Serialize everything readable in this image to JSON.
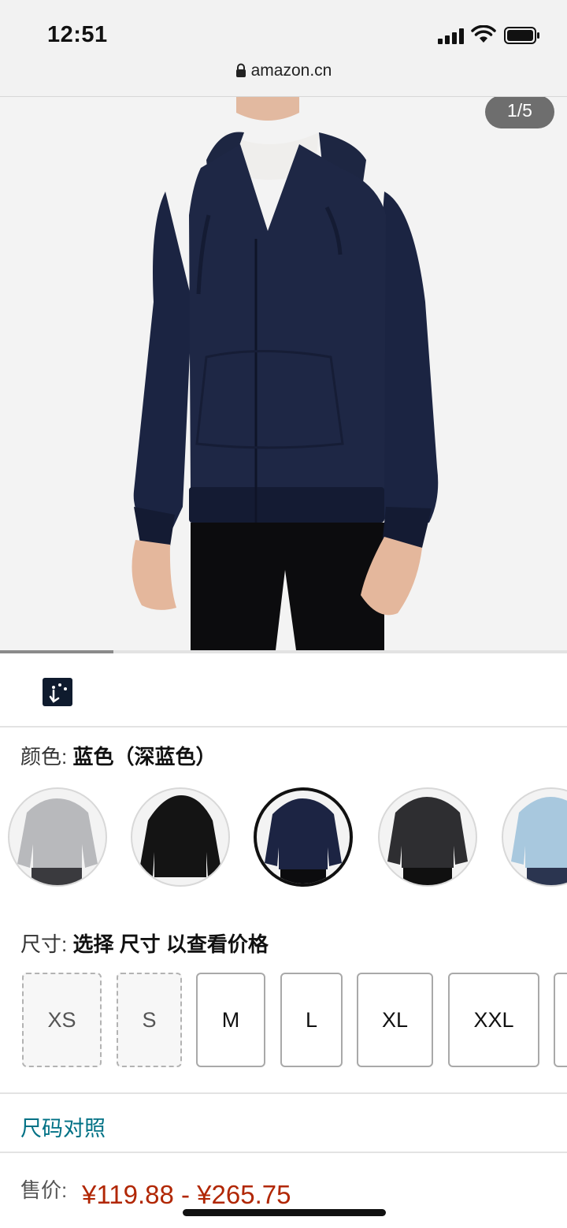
{
  "status_bar": {
    "time": "12:51"
  },
  "browser": {
    "url": "amazon.cn"
  },
  "gallery": {
    "counter": "1/5",
    "progress": 0.2
  },
  "color": {
    "label": "颜色: ",
    "value": "蓝色（深蓝色）"
  },
  "swatches": [
    {
      "name": "grey",
      "hex": "#b7b7ba"
    },
    {
      "name": "black",
      "hex": "#1a1a1a"
    },
    {
      "name": "navy",
      "hex": "#1b2340",
      "selected": true
    },
    {
      "name": "charcoal",
      "hex": "#2d2d30"
    },
    {
      "name": "light-blue",
      "hex": "#a9c9df"
    }
  ],
  "size": {
    "label": "尺寸: ",
    "value": "选择 尺寸 以查看价格"
  },
  "size_options": [
    "XS",
    "S",
    "M",
    "L",
    "XL",
    "XXL"
  ],
  "size_chart_link": "尺码对照",
  "price": {
    "label": "售价:",
    "value": "¥119.88 - ¥265.75"
  },
  "colors": {
    "link": "#007185",
    "price": "#b12704"
  }
}
